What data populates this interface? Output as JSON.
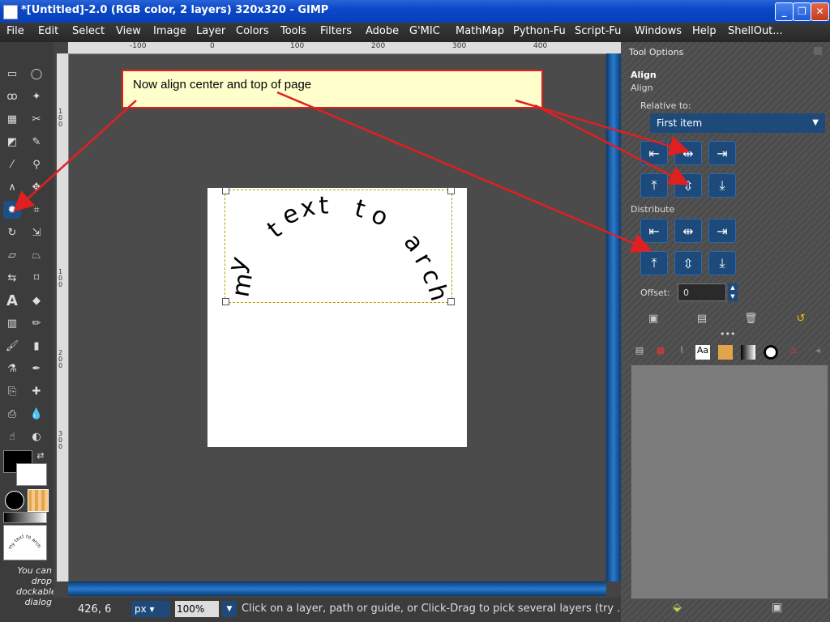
{
  "window": {
    "title": "*[Untitled]-2.0 (RGB color, 2 layers) 320x320 - GIMP",
    "minimize": "_",
    "maximize": "❐",
    "close": "✕"
  },
  "menu": [
    "File",
    "Edit",
    "Select",
    "View",
    "Image",
    "Layer",
    "Colors",
    "Tools",
    "Filters",
    "Adobe",
    "G'MIC",
    "MathMap",
    "Python-Fu",
    "Script-Fu",
    "Windows",
    "Help",
    "ShellOut..."
  ],
  "rulers": {
    "top": [
      "-100",
      "0",
      "100",
      "200",
      "300",
      "400"
    ],
    "left": [
      "1",
      "0",
      "0",
      "1",
      "0",
      "0",
      "2",
      "0",
      "0",
      "3",
      "0",
      "0"
    ]
  },
  "canvas": {
    "text_letters": [
      "m",
      "y",
      "t",
      "e",
      "x",
      "t",
      "t",
      "o",
      "a",
      "r",
      "c",
      "h"
    ]
  },
  "toolbox": {
    "thumb_label": "my text to arch",
    "drop_note": "You can drop dockable dialog"
  },
  "statusbar": {
    "coords": "426, 6",
    "unit": "px",
    "zoom": "100",
    "zoom_suffix": "%",
    "message": "Click on a layer, path or guide, or Click-Drag to pick several layers (try ..."
  },
  "dock": {
    "header": "Tool Options",
    "tool_name": "Align",
    "tool_subname": "Align",
    "relative_label": "Relative to:",
    "relative_value": "First item",
    "distribute_label": "Distribute",
    "offset_label": "Offset:",
    "offset_value": "0",
    "more": "•••"
  },
  "annotation": {
    "text": "Now align center and top of page"
  },
  "colors": {
    "accent_blue": "#1d4a7a",
    "annotation_bg": "#ffffcc",
    "annotation_border": "#e02020",
    "arrow": "#e02020"
  }
}
